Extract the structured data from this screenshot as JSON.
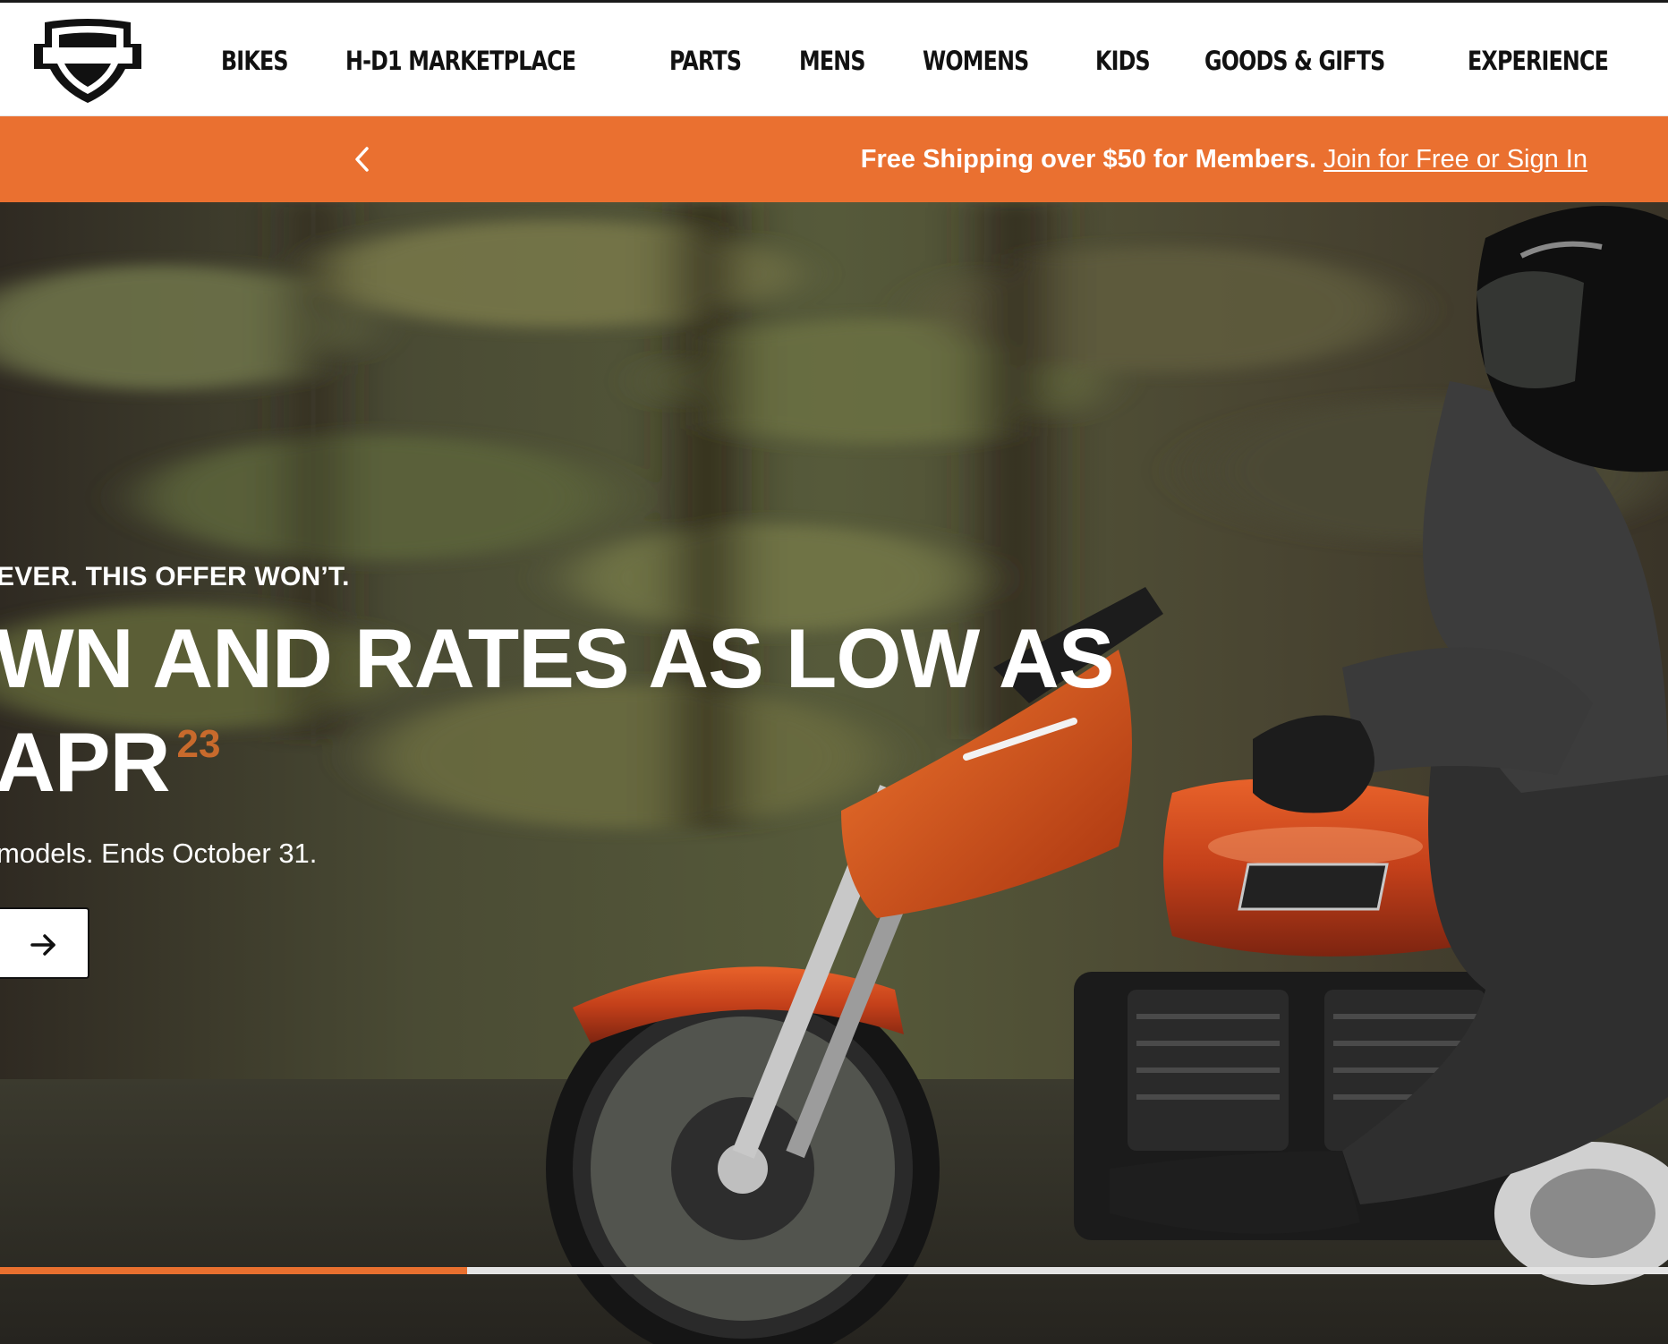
{
  "header": {
    "logo_name": "harley-davidson-bar-and-shield-logo",
    "nav": [
      {
        "label": "BIKES"
      },
      {
        "label": "H-D1 MARKETPLACE"
      },
      {
        "label": "PARTS"
      },
      {
        "label": "MENS"
      },
      {
        "label": "WOMENS"
      },
      {
        "label": "KIDS"
      },
      {
        "label": "GOODS & GIFTS"
      },
      {
        "label": "EXPERIENCE"
      }
    ]
  },
  "promo_bar": {
    "bold_text": "Free Shipping over $50 for Members.",
    "link_text": "Join for Free or Sign In",
    "prev_icon": "chevron-left-icon",
    "background_color": "#ea7030"
  },
  "hero": {
    "kicker": "EVER. THIS OFFER WON’T.",
    "headline_line1": "WN AND RATES AS LOW AS",
    "headline_line2": "APR",
    "footnote": "23",
    "subtext": "models. Ends October 31.",
    "cta_icon": "arrow-right-icon",
    "footnote_color": "#c86a2c"
  },
  "carousel": {
    "progress_fraction": 0.28,
    "progress_color": "#e8702f"
  }
}
